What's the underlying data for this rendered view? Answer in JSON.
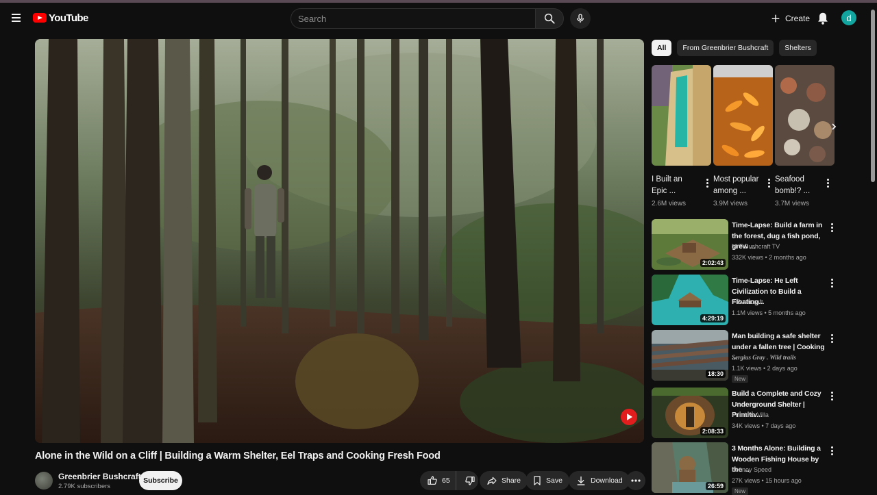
{
  "header": {
    "logo_text": "YouTube",
    "search_placeholder": "Search",
    "create_label": "Create",
    "avatar_letter": "d"
  },
  "video": {
    "title": "Alone in the Wild on a Cliff | Building a Warm Shelter, Eel Traps and Cooking Fresh Food",
    "channel": "Greenbrier Bushcraft",
    "subscribers": "2.79K subscribers",
    "subscribe_label": "Subscribe",
    "likes": "65",
    "share_label": "Share",
    "save_label": "Save",
    "download_label": "Download"
  },
  "sidebar": {
    "chips": [
      {
        "label": "All",
        "active": true
      },
      {
        "label": "From Greenbrier Bushcraft",
        "active": false
      },
      {
        "label": "Shelters",
        "active": false
      }
    ],
    "shorts": [
      {
        "title": "I Built an Epic ...",
        "views": "2.6M views"
      },
      {
        "title": "Most popular among ...",
        "views": "3.9M views"
      },
      {
        "title": "Seafood bomb!? ...",
        "views": "3.7M views"
      }
    ],
    "recommendations": [
      {
        "title": "Time-Lapse: Build a farm in the forest, dug a fish pond, grew ...",
        "channel": "MrT Bushcraft TV",
        "meta": "332K views • 2 months ago",
        "duration": "2:02:43",
        "badge": ""
      },
      {
        "title": "Time-Lapse: He Left Civilization to Build a Floating...",
        "channel": "7 Bushcraft",
        "meta": "1.1M views • 5 months ago",
        "duration": "4:29:19",
        "badge": ""
      },
      {
        "title": "Man building a safe shelter under a fallen tree | Cooking ...",
        "channel": "Sergius Gray . Wild trails",
        "meta": "1.1K views • 2 days ago",
        "duration": "18:30",
        "badge": "New"
      },
      {
        "title": "Build a Complete and Cozy Underground Shelter | Primitiv...",
        "channel": "Primitive Villa",
        "meta": "34K views • 7 days ago",
        "duration": "2:08:33",
        "badge": ""
      },
      {
        "title": "3 Months Alone: Building a Wooden Fishing House by the ...",
        "channel": "Leanoy Speed",
        "meta": "27K views • 15 hours ago",
        "duration": "26:59",
        "badge": "New"
      }
    ]
  },
  "colors": {
    "background": "#0f0f0f",
    "brand_red": "#ff0000",
    "avatar": "#12a5a0",
    "pill": "#272727"
  }
}
